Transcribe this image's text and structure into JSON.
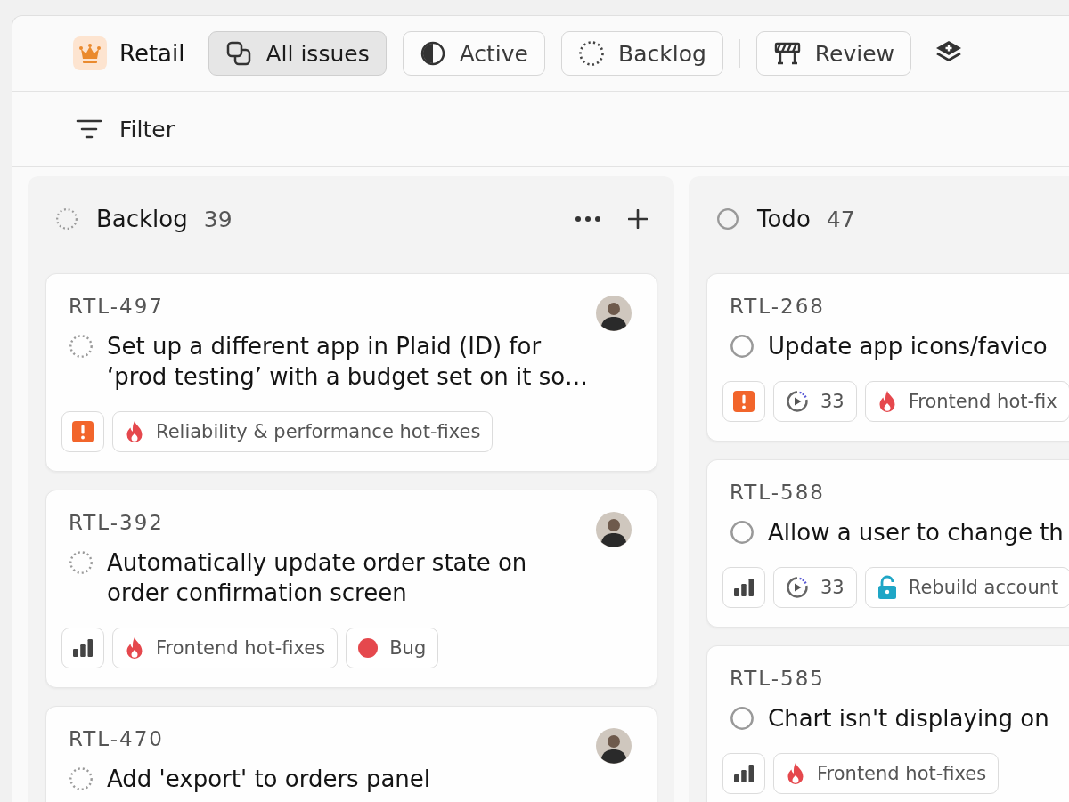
{
  "workspace": {
    "name": "Retail"
  },
  "views": [
    {
      "kind": "all",
      "label": "All issues",
      "selected": true
    },
    {
      "kind": "active",
      "label": "Active",
      "selected": false
    },
    {
      "kind": "backlog",
      "label": "Backlog",
      "selected": false
    }
  ],
  "saved_views": [
    {
      "kind": "review",
      "label": "Review",
      "selected": false
    }
  ],
  "filter": {
    "label": "Filter"
  },
  "columns": [
    {
      "kind": "backlog",
      "title": "Backlog",
      "count": "39",
      "cards": [
        {
          "id": "RTL-497",
          "assigned": true,
          "title": "Set up a different app in Plaid (ID) for ‘prod testing’ with a budget set on it so…",
          "tags": [
            {
              "kind": "urgent"
            },
            {
              "kind": "fire",
              "label": "Reliability & performance hot-fixes"
            }
          ]
        },
        {
          "id": "RTL-392",
          "assigned": true,
          "title": "Automatically update order state on order confirmation screen",
          "tags": [
            {
              "kind": "high"
            },
            {
              "kind": "fire",
              "label": "Frontend hot-fixes"
            },
            {
              "kind": "label",
              "label": "Bug",
              "color": "#e5484d"
            }
          ]
        },
        {
          "id": "RTL-470",
          "assigned": true,
          "title": "Add 'export' to orders panel"
        }
      ]
    },
    {
      "kind": "todo",
      "title": "Todo",
      "count": "47",
      "cards": [
        {
          "id": "RTL-268",
          "title": "Update app icons/favico",
          "tags": [
            {
              "kind": "urgent"
            },
            {
              "kind": "cycle",
              "label": "33"
            },
            {
              "kind": "fire",
              "label": "Frontend hot-fix"
            }
          ]
        },
        {
          "id": "RTL-588",
          "title": "Allow a user to change th",
          "tags": [
            {
              "kind": "high"
            },
            {
              "kind": "cycle",
              "label": "33"
            },
            {
              "kind": "lock",
              "label": "Rebuild account"
            }
          ]
        },
        {
          "id": "RTL-585",
          "title": "Chart isn't displaying on",
          "tags": [
            {
              "kind": "high"
            },
            {
              "kind": "fire",
              "label": "Frontend hot-fixes"
            }
          ]
        }
      ]
    }
  ]
}
